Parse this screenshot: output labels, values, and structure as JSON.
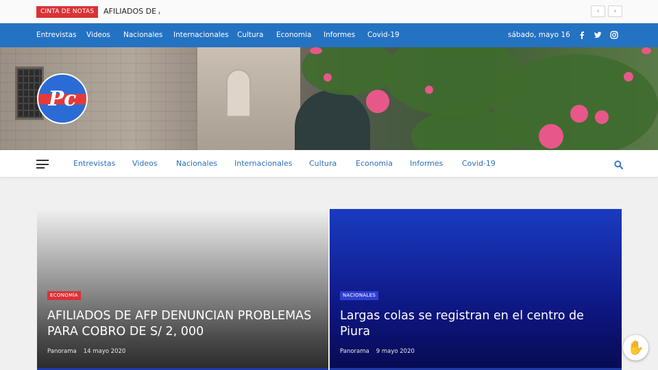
{
  "ticker": {
    "label": "CINTA DE NOTAS",
    "text": "AFILIADOS DE /_",
    "prev_icon": "chevron-left-icon",
    "next_icon": "chevron-right-icon"
  },
  "topnav": {
    "items": [
      "Entrevistas",
      "Videos",
      "Nacionales",
      "Internacionales",
      "Cultura",
      "Economia",
      "Informes",
      "Covid-19"
    ],
    "date": "sábado, mayo 16",
    "social": [
      "facebook-icon",
      "twitter-icon",
      "instagram-icon"
    ],
    "color": "#2472c2"
  },
  "logo": {
    "text": "Pc"
  },
  "mainnav": {
    "items": [
      "Entrevistas",
      "Videos",
      "Nacionales",
      "Internacionales",
      "Cultura",
      "Economia",
      "Informes",
      "Covid-19"
    ],
    "menu_icon": "hamburger-menu-icon",
    "search_icon": "search-icon"
  },
  "cards": [
    {
      "category": "ECONOMÍA",
      "title": "AFILIADOS DE AFP DENUNCIAN PROBLEMAS PARA COBRO DE S/ 2, 000",
      "author": "Panorama",
      "date": "14 mayo 2020",
      "tag_color": "#d93236"
    },
    {
      "category": "NACIONALES",
      "title": "Largas colas se registran en el centro de Piura",
      "author": "Panorama",
      "date": "9 mayo 2020",
      "tag_color": "#2f3fd2"
    }
  ],
  "accessibility": {
    "icon": "hand-icon"
  }
}
